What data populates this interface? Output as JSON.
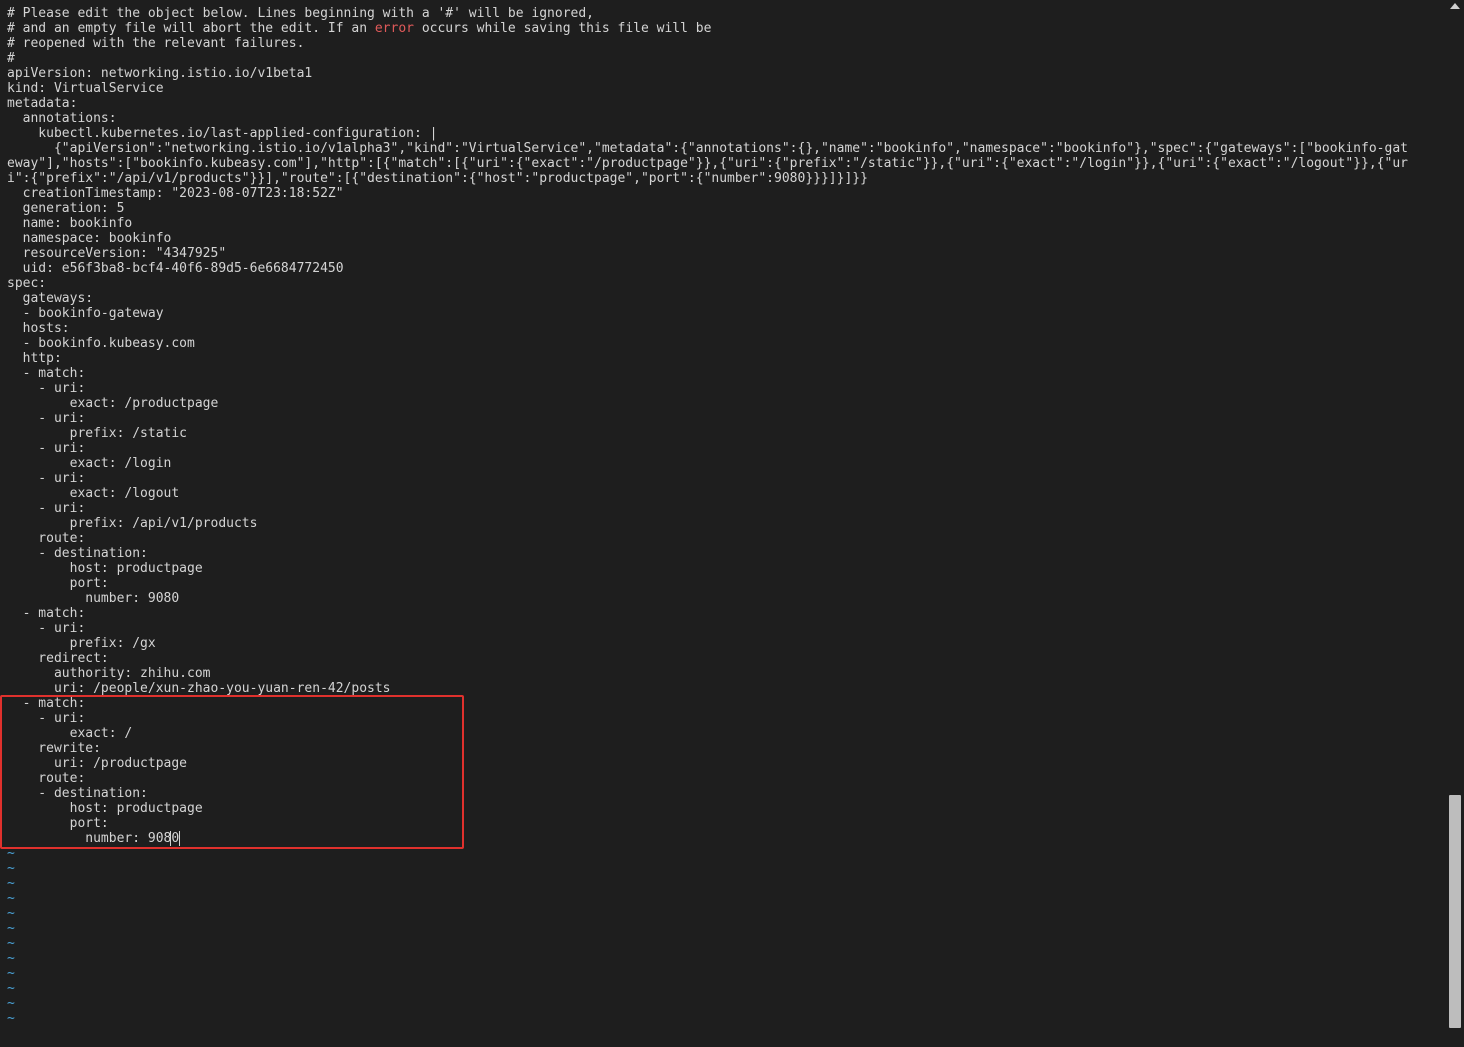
{
  "editor": {
    "lines": [
      "# Please edit the object below. Lines beginning with a '#' will be ignored,",
      "# and an empty file will abort the edit. If an error occurs while saving this file will be",
      "# reopened with the relevant failures.",
      "#",
      "apiVersion: networking.istio.io/v1beta1",
      "kind: VirtualService",
      "metadata:",
      "  annotations:",
      "    kubectl.kubernetes.io/last-applied-configuration: |",
      "      {\"apiVersion\":\"networking.istio.io/v1alpha3\",\"kind\":\"VirtualService\",\"metadata\":{\"annotations\":{},\"name\":\"bookinfo\",\"namespace\":\"bookinfo\"},\"spec\":{\"gateways\":[\"bookinfo-gat",
      "eway\"],\"hosts\":[\"bookinfo.kubeasy.com\"],\"http\":[{\"match\":[{\"uri\":{\"exact\":\"/productpage\"}},{\"uri\":{\"prefix\":\"/static\"}},{\"uri\":{\"exact\":\"/login\"}},{\"uri\":{\"exact\":\"/logout\"}},{\"ur",
      "i\":{\"prefix\":\"/api/v1/products\"}}],\"route\":[{\"destination\":{\"host\":\"productpage\",\"port\":{\"number\":9080}}}]}]}}",
      "  creationTimestamp: \"2023-08-07T23:18:52Z\"",
      "  generation: 5",
      "  name: bookinfo",
      "  namespace: bookinfo",
      "  resourceVersion: \"4347925\"",
      "  uid: e56f3ba8-bcf4-40f6-89d5-6e6684772450",
      "spec:",
      "  gateways:",
      "  - bookinfo-gateway",
      "  hosts:",
      "  - bookinfo.kubeasy.com",
      "  http:",
      "  - match:",
      "    - uri:",
      "        exact: /productpage",
      "    - uri:",
      "        prefix: /static",
      "    - uri:",
      "        exact: /login",
      "    - uri:",
      "        exact: /logout",
      "    - uri:",
      "        prefix: /api/v1/products",
      "    route:",
      "    - destination:",
      "        host: productpage",
      "        port:",
      "          number: 9080",
      "  - match:",
      "    - uri:",
      "        prefix: /gx",
      "    redirect:",
      "      authority: zhihu.com",
      "      uri: /people/xun-zhao-you-yuan-ren-42/posts",
      "  - match:",
      "    - uri:",
      "        exact: /",
      "    rewrite:",
      "      uri: /productpage",
      "    route:",
      "    - destination:",
      "        host: productpage",
      "        port:",
      "          number: 908"
    ],
    "error_line": {
      "before": "# and an empty file will abort the edit. If an ",
      "keyword": "error",
      "after": " occurs while saving this file will be"
    },
    "cursor_char": "0",
    "tilde": "~",
    "tilde_count": 12,
    "colors": {
      "background": "#1e1e1e",
      "text": "#d4d4d4",
      "error_keyword": "#e05a5a",
      "tilde": "#4aa3d8",
      "highlight_border": "#e0312d",
      "scrollbar_thumb": "#bdbdbd"
    }
  }
}
